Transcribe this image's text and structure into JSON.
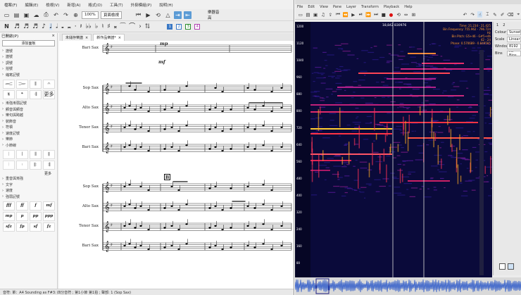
{
  "musescore": {
    "menu": [
      "檔案(F)",
      "編輯(E)",
      "檢視(V)",
      "新增(A)",
      "格式(O)",
      "工具(T)",
      "外掛模組(P)",
      "說明(H)"
    ],
    "zoom": "100%",
    "view_mode": "頁面檢視",
    "concert_label": "樂器音高",
    "voices": [
      "1",
      "2",
      "3",
      "4"
    ],
    "palette": {
      "title": "已開啟(P)",
      "search_label": "添加面板",
      "sections_top": [
        "譜號",
        "譜號",
        "調號",
        "拍號",
        "縮寫記號"
      ],
      "grid1": [
        "𝆒",
        "𝆓",
        "𝄃",
        "𝄐",
        "𝄋",
        "𝄌",
        "𝄇",
        "更多"
      ],
      "sections_mid": [
        "漸強漸弱記號",
        "顫音與顫音",
        "樂句與跨越",
        "裝飾音",
        "符槓",
        "速度記號",
        "樂節",
        "小節線"
      ],
      "grid2": [
        "𝄀",
        "𝄁",
        "𝄂",
        "𝄃",
        "𝄄",
        "𝄅",
        "𝄆",
        "𝄇"
      ],
      "more": "更多",
      "sections_bottom": [
        "重音與漸強",
        "文字",
        "速度",
        "強弱記號"
      ],
      "dynamics": [
        "fff",
        "ff",
        "f",
        "mf",
        "mp",
        "p",
        "pp",
        "ppp",
        "sfz",
        "fp",
        "sf",
        "fz"
      ]
    },
    "tabs": [
      {
        "label": "未儲存樂譜"
      },
      {
        "label": "新作品樂譜*"
      }
    ],
    "instruments": [
      "Bari Sax",
      "Sop Sax",
      "Alto Sax",
      "Tenor Sax",
      "Bari Sax",
      "Sop Sax",
      "Alto Sax",
      "Tenor Sax",
      "Bari Sax"
    ],
    "rehearsal_mark": "B",
    "dynamic_marks": [
      "mp",
      "mf"
    ],
    "status": "音符: 單：A4 Sounding as F#3: 四分音符 ; 第1小節 第1拍 ; 聲部: 1 (Sop Sax)"
  },
  "sonic": {
    "menu": [
      "File",
      "Edit",
      "View",
      "Pane",
      "Layer",
      "Transform",
      "Playback",
      "Help"
    ],
    "readout_left": "18,842",
    "readout_right": "830976",
    "info": [
      "Time: 21.234 - 21.425",
      "Bin Frequency: 755.962 - 796.724 Hz",
      "Bin Pitch: G5+46 - G#5+46 ",
      "42 - 24",
      "Phase: 0.570689 - 0.849585"
    ],
    "side": {
      "tabs": [
        "1",
        "2"
      ],
      "props": [
        {
          "k": "Colour",
          "v": "Sunset"
        },
        {
          "k": "Scale",
          "v": "Linear"
        },
        {
          "k": "Window",
          "v": "8192"
        },
        {
          "k": "Bins",
          "v": "All Bins"
        }
      ]
    },
    "freq_labels": [
      "1200",
      "1120",
      "1040",
      "960",
      "880",
      "800",
      "720",
      "640",
      "560",
      "480",
      "400",
      "320",
      "240",
      "160",
      "80"
    ]
  }
}
